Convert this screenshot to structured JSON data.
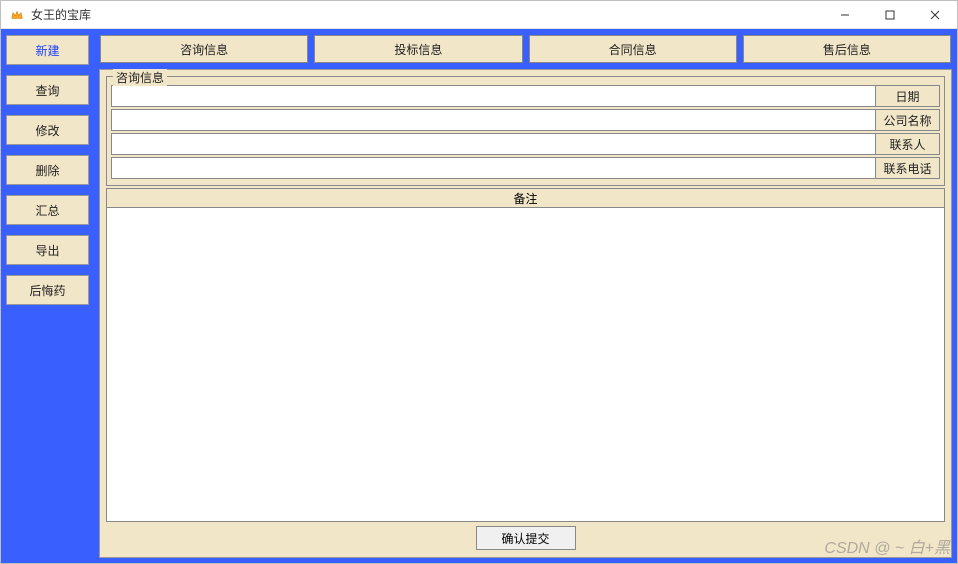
{
  "window": {
    "title": "女王的宝库"
  },
  "sidebar": {
    "items": [
      {
        "label": "新建",
        "active": true
      },
      {
        "label": "查询",
        "active": false
      },
      {
        "label": "修改",
        "active": false
      },
      {
        "label": "删除",
        "active": false
      },
      {
        "label": "汇总",
        "active": false
      },
      {
        "label": "导出",
        "active": false
      },
      {
        "label": "后悔药",
        "active": false
      }
    ]
  },
  "tabs": [
    {
      "label": "咨询信息"
    },
    {
      "label": "投标信息"
    },
    {
      "label": "合同信息"
    },
    {
      "label": "售后信息"
    }
  ],
  "form": {
    "group_title": "咨询信息",
    "fields": [
      {
        "label": "日期",
        "value": ""
      },
      {
        "label": "公司名称",
        "value": ""
      },
      {
        "label": "联系人",
        "value": ""
      },
      {
        "label": "联系电话",
        "value": ""
      }
    ],
    "remarks_label": "备注",
    "remarks_value": ""
  },
  "actions": {
    "submit_label": "确认提交"
  },
  "watermark": "CSDN @ ~ 白+黑"
}
